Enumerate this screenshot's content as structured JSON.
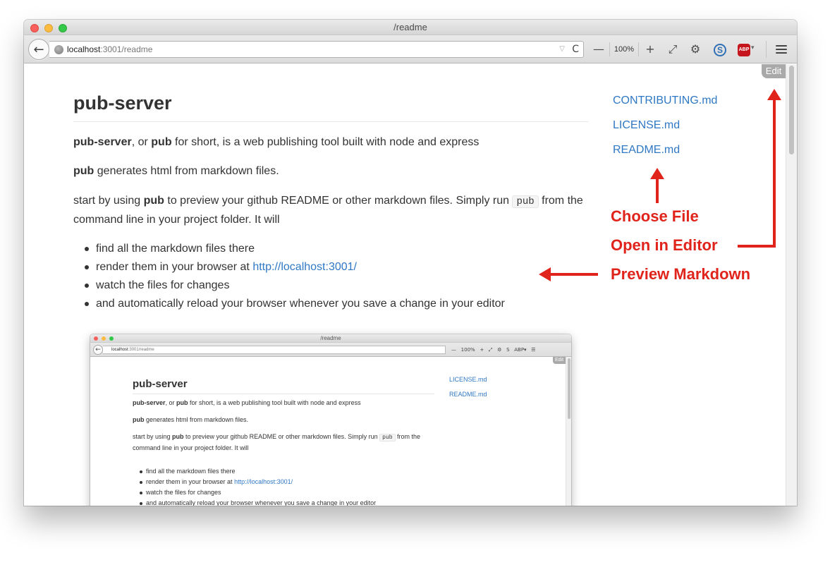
{
  "window": {
    "title": "/readme"
  },
  "toolbar": {
    "back_glyph": "←",
    "url_host": "localhost",
    "url_rest": ":3001/readme",
    "url_dropdown": "▽",
    "reload_glyph": "C",
    "zoom_out": "—",
    "zoom_level": "100%",
    "zoom_in": "+",
    "fullscreen_glyph": "⤢",
    "settings_glyph": "⚙",
    "s_ext_label": "S",
    "abp_label": "ABP",
    "abp_drop": "▾"
  },
  "edit_button": "Edit",
  "content": {
    "heading": "pub-server",
    "p1_bold1": "pub-server",
    "p1_mid": ", or ",
    "p1_bold2": "pub",
    "p1_rest": " for short, is a web publishing tool built with node and express",
    "p2_bold": "pub",
    "p2_rest": " generates html from markdown files.",
    "p3_start": "start by using ",
    "p3_bold": "pub",
    "p3_mid": " to preview your github README or other markdown files. Simply run ",
    "p3_code": "pub",
    "p3_end": " from the command line in your project folder. It will",
    "bullets": [
      {
        "text": "find all the markdown files there"
      },
      {
        "text": "render them in your browser at ",
        "link": "http://localhost:3001/"
      },
      {
        "text": "watch the files for changes"
      },
      {
        "text": "and automatically reload your browser whenever you save a change in your editor"
      }
    ]
  },
  "sidebar": {
    "files": [
      "CONTRIBUTING.md",
      "LICENSE.md",
      "README.md"
    ]
  },
  "annotations": {
    "choose_file": "Choose File",
    "open_in_editor": "Open in Editor",
    "preview_markdown": "Preview Markdown",
    "color": "#e0231b"
  },
  "mini": {
    "title": "/readme",
    "url_host": "localhost",
    "url_rest": ":3001/readme",
    "tools": "—   100%   +   ⤢   ⚙   S   ABP▾   ☰",
    "edit": "Edit",
    "heading": "pub-server",
    "files": [
      "LICENSE.md",
      "README.md"
    ]
  }
}
